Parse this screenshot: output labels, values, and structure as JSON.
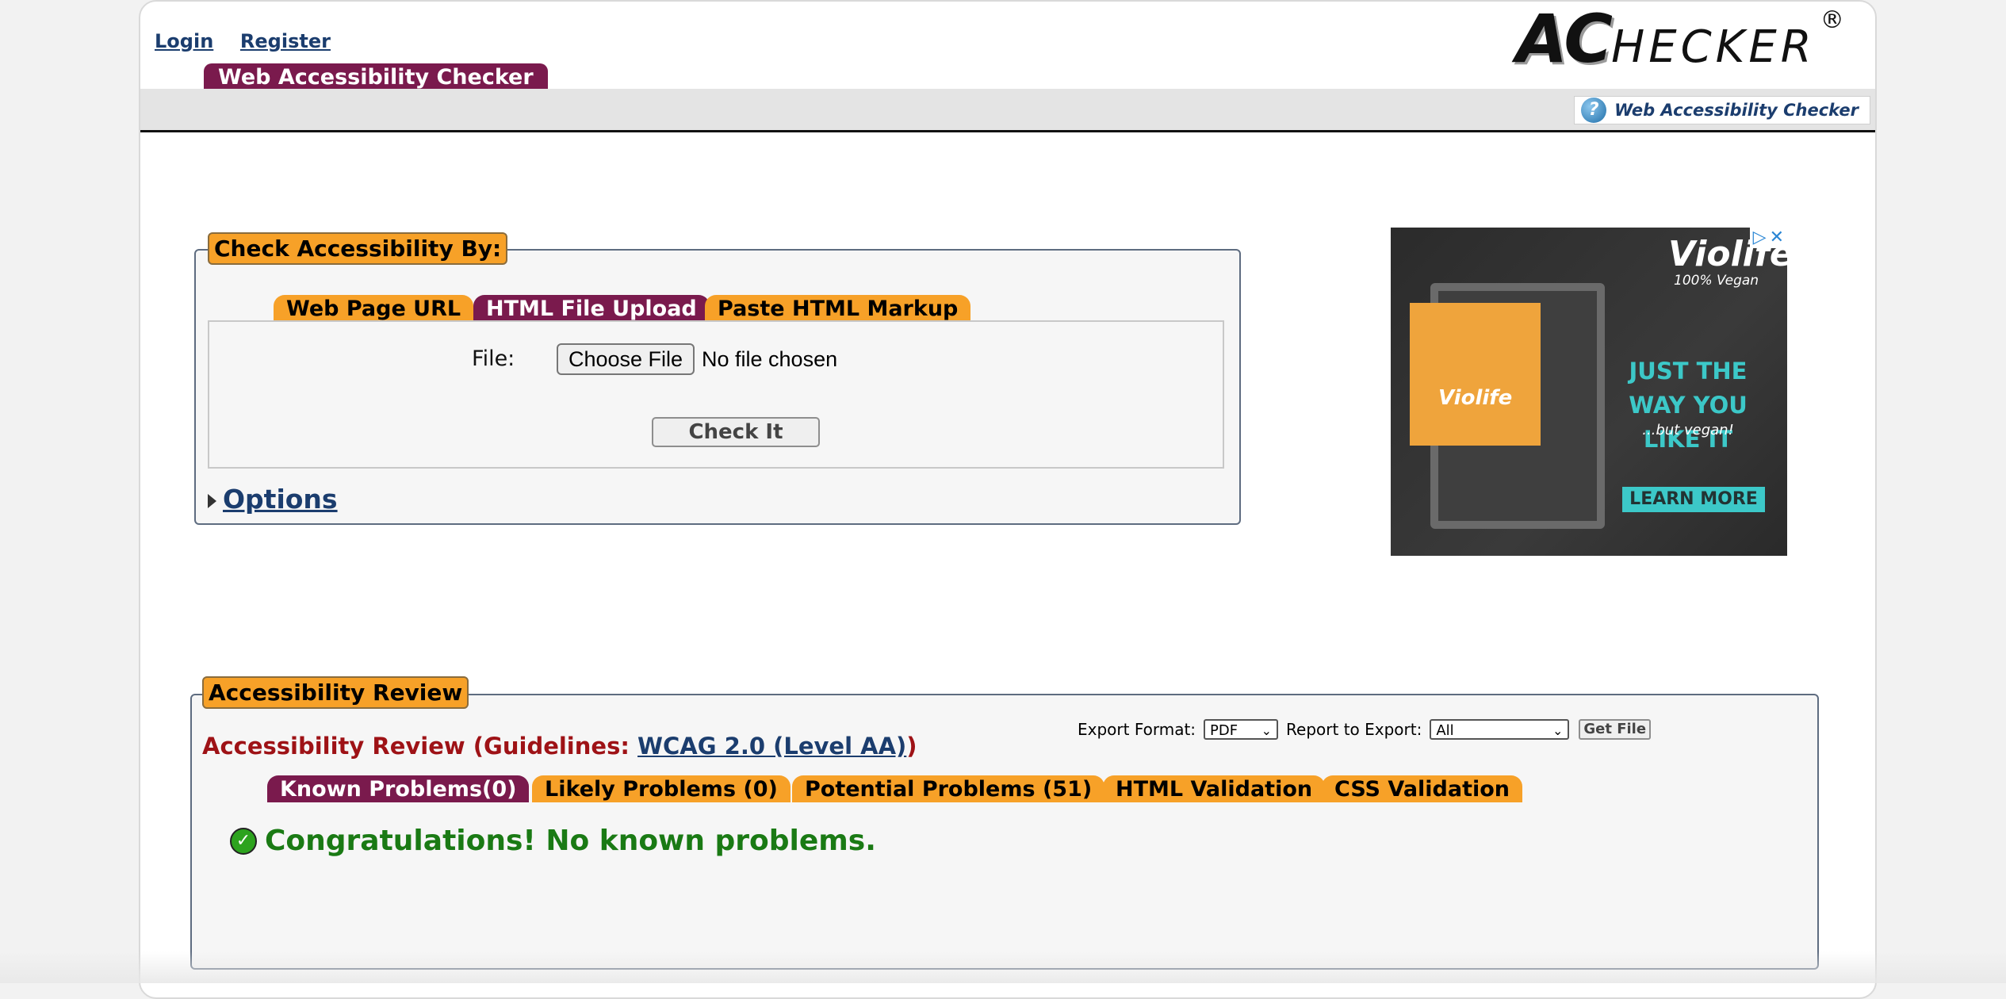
{
  "header": {
    "login_label": "Login",
    "register_label": "Register",
    "logo_big": "AC",
    "logo_rest": "HECKER",
    "logo_reg": "®",
    "site_tab": "Web Accessibility Checker",
    "help_link": "Web Accessibility Checker",
    "help_icon": "?"
  },
  "check": {
    "legend": "Check Accessibility By:",
    "tabs": [
      {
        "label": "Web Page URL",
        "active": false
      },
      {
        "label": "HTML File Upload",
        "active": true
      },
      {
        "label": "Paste HTML Markup",
        "active": false
      }
    ],
    "file_label": "File:",
    "choose_button": "Choose File",
    "no_file": "No file chosen",
    "check_button": "Check It",
    "options_label": "Options"
  },
  "ad": {
    "brand": "Violife",
    "sub": "100% Vegan",
    "headline": "JUST THE WAY YOU LIKE IT",
    "tagline": "...but vegan!",
    "cta": "LEARN MORE",
    "pack_brand": "Violife"
  },
  "review": {
    "legend": "Accessibility Review",
    "title_prefix": "Accessibility Review (Guidelines: ",
    "guideline_link": "WCAG 2.0 (Level AA)",
    "title_suffix": ")",
    "export_format_label": "Export Format:",
    "export_format_value": "PDF",
    "report_label": "Report to Export:",
    "report_value": "All",
    "get_file_button": "Get File",
    "tabs": [
      {
        "label": "Known Problems(0)",
        "active": true
      },
      {
        "label": "Likely Problems (0)",
        "active": false
      },
      {
        "label": "Potential Problems (51)",
        "active": false
      },
      {
        "label": "HTML Validation",
        "active": false
      },
      {
        "label": "CSS Validation",
        "active": false
      }
    ],
    "congrats": "Congratulations! No known problems."
  },
  "colors": {
    "tab_orange": "#f7a128",
    "tab_active": "#7a1a4d",
    "link_blue": "#1b3d6e",
    "review_red": "#9e1216",
    "success_green": "#1a7a14"
  }
}
